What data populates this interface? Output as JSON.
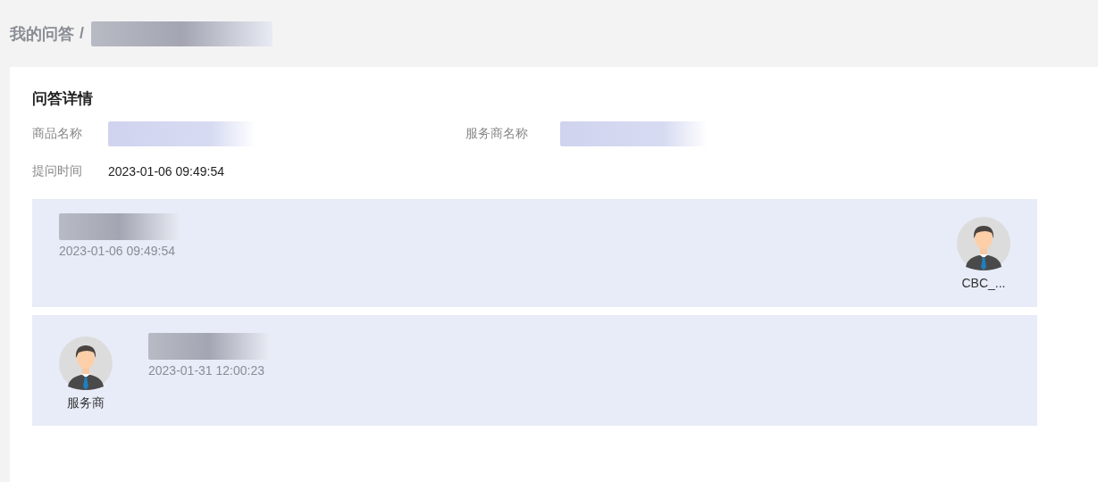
{
  "breadcrumb": {
    "items": [
      "我的问答"
    ],
    "separator": "/"
  },
  "detail": {
    "title": "问答详情",
    "fields": [
      {
        "label": "商品名称",
        "kind": "redacted"
      },
      {
        "label": "服务商名称",
        "kind": "redacted"
      },
      {
        "label": "提问时间",
        "kind": "text",
        "value": "2023-01-06 09:49:54"
      }
    ]
  },
  "messages": [
    {
      "kind": "question",
      "time": "2023-01-06 09:49:54",
      "author": "CBC_..."
    },
    {
      "kind": "answer",
      "time": "2023-01-31 12:00:23",
      "author": "服务商"
    }
  ]
}
